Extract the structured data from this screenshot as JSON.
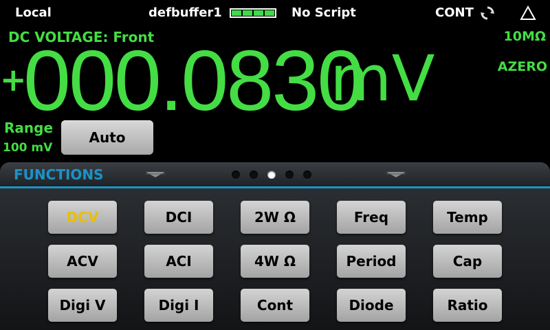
{
  "status_bar": {
    "mode": "Local",
    "buffer": "defbuffer1",
    "battery_cells": 4,
    "script": "No Script",
    "trigger_mode": "CONT",
    "icons": [
      "refresh-icon",
      "warning-triangle-icon"
    ]
  },
  "measurement": {
    "function_title": "DC VOLTAGE: Front",
    "input_impedance": "10MΩ",
    "autozero": "AZERO",
    "reading_sign": "+",
    "reading_digits": "000.0830",
    "reading_unit": "mV",
    "range_label": "Range",
    "range_value": "100 mV",
    "range_button": "Auto"
  },
  "panel": {
    "title": "FUNCTIONS",
    "page_count": 5,
    "active_page": 3
  },
  "functions": [
    {
      "label": "DCV",
      "selected": true
    },
    {
      "label": "DCI",
      "selected": false
    },
    {
      "label": "2W Ω",
      "selected": false
    },
    {
      "label": "Freq",
      "selected": false
    },
    {
      "label": "Temp",
      "selected": false
    },
    {
      "label": "ACV",
      "selected": false
    },
    {
      "label": "ACI",
      "selected": false
    },
    {
      "label": "4W Ω",
      "selected": false
    },
    {
      "label": "Period",
      "selected": false
    },
    {
      "label": "Cap",
      "selected": false
    },
    {
      "label": "Digi V",
      "selected": false
    },
    {
      "label": "Digi I",
      "selected": false
    },
    {
      "label": "Cont",
      "selected": false
    },
    {
      "label": "Diode",
      "selected": false
    },
    {
      "label": "Ratio",
      "selected": false
    }
  ],
  "colors": {
    "reading_green": "#44dd44",
    "accent_blue": "#1a93c9",
    "selected_yellow": "#e8c000"
  }
}
